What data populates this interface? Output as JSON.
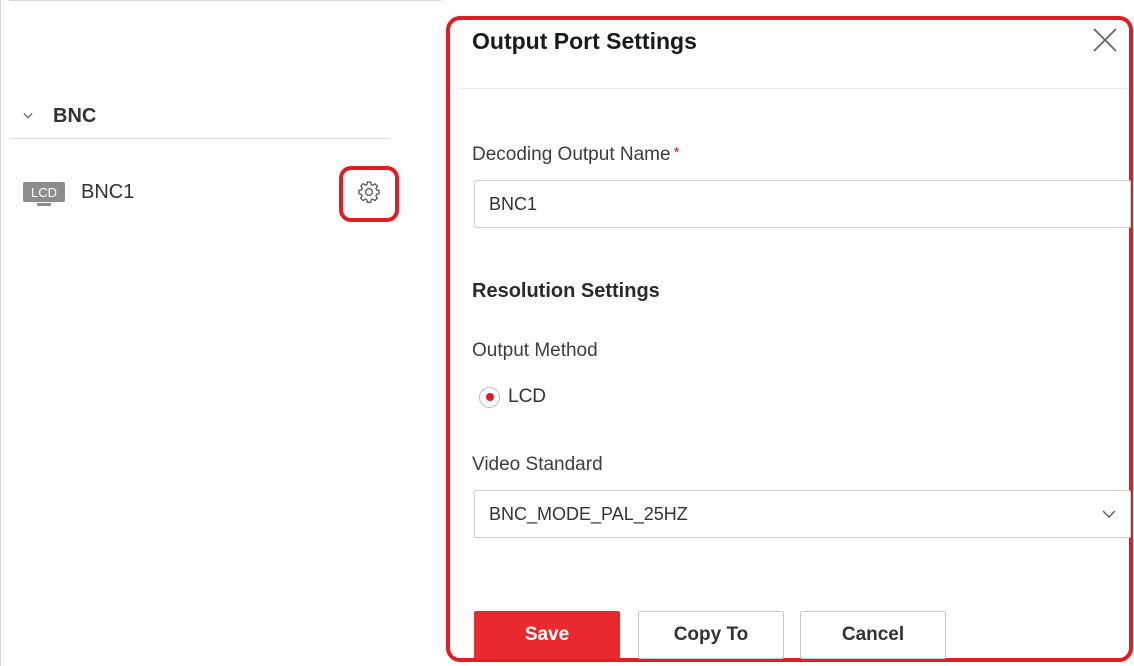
{
  "left_panel": {
    "group": {
      "title": "BNC",
      "expanded_icon": "chevron-down-icon"
    },
    "ports": [
      {
        "badge": "LCD",
        "name": "BNC1",
        "settings_icon": "gear-icon"
      }
    ]
  },
  "dialog": {
    "title": "Output Port Settings",
    "close_icon": "close-icon",
    "decoding_output_name": {
      "label": "Decoding Output Name",
      "required_mark": "*",
      "value": "BNC1"
    },
    "resolution_section_title": "Resolution Settings",
    "output_method": {
      "label": "Output Method",
      "options": [
        {
          "label": "LCD",
          "selected": true
        }
      ]
    },
    "video_standard": {
      "label": "Video Standard",
      "selected": "BNC_MODE_PAL_25HZ",
      "dropdown_icon": "chevron-down-icon"
    },
    "buttons": {
      "save": "Save",
      "copy_to": "Copy To",
      "cancel": "Cancel"
    }
  },
  "colors": {
    "accent": "#e82a2f",
    "highlight_border": "#e31b23"
  }
}
